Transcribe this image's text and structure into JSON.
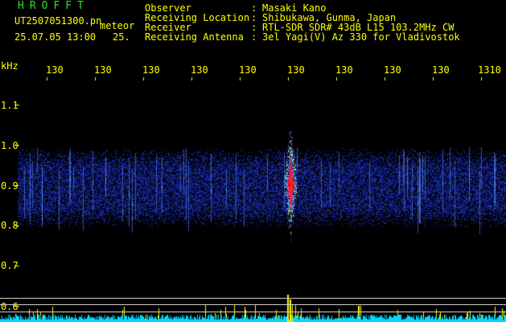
{
  "header": {
    "logo": "HROFFT",
    "filename": "UT2507051300.pn",
    "mode": "meteor",
    "datetime": "25.07.05 13:00",
    "count": "25.",
    "rows": [
      {
        "label": "Observer",
        "value": "Masaki Kano"
      },
      {
        "label": "Receiving Location",
        "value": "Shibukawa, Gunma, Japan"
      },
      {
        "label": "Receiver",
        "value": "RTL-SDR SDR# 43dB L15 103.2MHz CW"
      },
      {
        "label": "Receiving Antenna",
        "value": "3el Yagi(V) Az 330 for Vladivostok"
      }
    ],
    "separator": ":"
  },
  "axis": {
    "unit": "kHz",
    "top_labels": [
      "130",
      "130",
      "130",
      "130",
      "130",
      "130",
      "130",
      "130",
      "130",
      "1310"
    ],
    "y_labels": [
      "1.1",
      "1.0",
      "0.9",
      "0.8",
      "0.7",
      "0.6"
    ]
  },
  "colors": {
    "text": "#ffff00",
    "logo": "#2ee02e",
    "background": "#000000",
    "noise": "#1a3bd6",
    "echo_core": "#ff2020",
    "histogram": "#00d8ff",
    "histogram_peak": "#ffff00"
  }
}
